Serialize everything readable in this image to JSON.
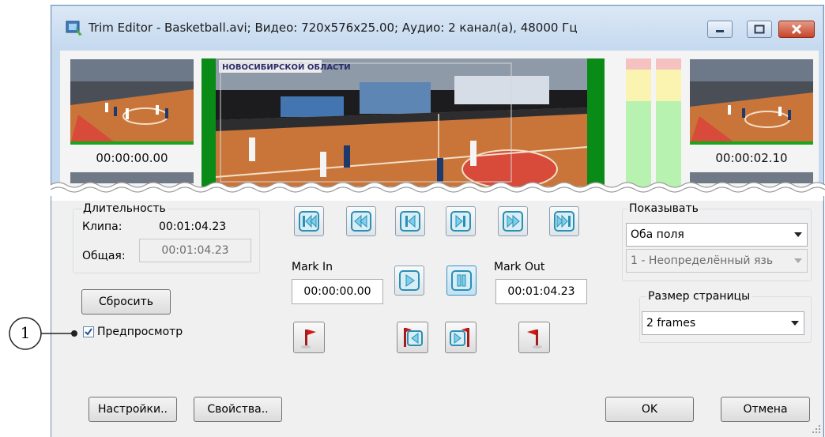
{
  "window": {
    "title": "Trim Editor - Basketball.avi; Видео: 720x576x25.00; Аудио: 2 канал(а), 48000 Гц"
  },
  "preview": {
    "left_timecode": "00:00:00.00",
    "right_timecode": "00:00:02.10",
    "banner_text": "НОВОСИБИРСКОЙ ОБЛАСТИ"
  },
  "duration": {
    "legend": "Длительность",
    "clip_label": "Клипа:",
    "clip_value": "00:01:04.23",
    "total_label": "Общая:",
    "total_value": "00:01:04.23"
  },
  "buttons": {
    "reset": "Сбросить",
    "settings": "Настройки..",
    "properties": "Свойства..",
    "ok": "OK",
    "cancel": "Отмена"
  },
  "preview_checkbox": {
    "label": "Предпросмотр",
    "checked": true
  },
  "callout": {
    "number": "1"
  },
  "marks": {
    "in_label": "Mark In",
    "in_value": "00:00:00.00",
    "out_label": "Mark Out",
    "out_value": "00:01:04.23"
  },
  "show": {
    "legend": "Показывать",
    "fields_value": "Оба поля",
    "language_value": "1 - Неопределённый язь"
  },
  "page_size": {
    "legend": "Размер страницы",
    "value": "2 frames"
  },
  "colors": {
    "accent": "#2a8fb5",
    "flag_red": "#d11818",
    "frame_blue": "#c5d9ef",
    "pitch_orange": "#c9753a",
    "meter_green": "#b8f2b0"
  }
}
